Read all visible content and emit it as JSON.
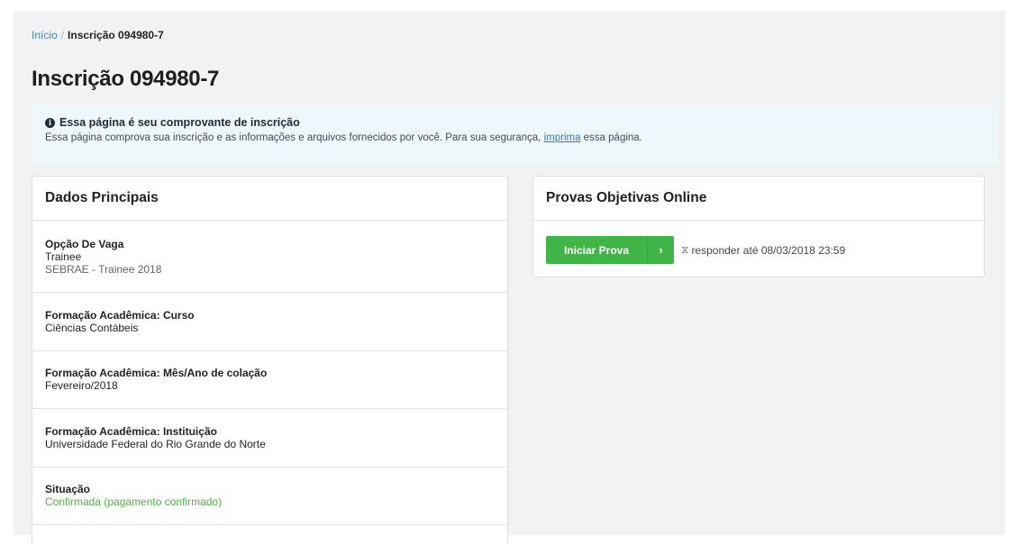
{
  "breadcrumb": {
    "home": "Início",
    "separator": "/",
    "current": "Inscrição 094980-7"
  },
  "page_title": "Inscrição 094980-7",
  "alert": {
    "icon": "info-circle-icon",
    "title": "Essa página é seu comprovante de inscrição",
    "text_before": "Essa página comprova sua inscrição e as informações e arquivos fornecidos por você. Para sua segurança, ",
    "link": "imprima",
    "text_after": " essa página."
  },
  "main_panel": {
    "heading": "Dados Principais",
    "items": [
      {
        "label": "Opção De Vaga",
        "value": "Trainee",
        "sub": "SEBRAE - Trainee 2018"
      },
      {
        "label": "Formação Acadêmica: Curso",
        "value": "Ciências Contábeis"
      },
      {
        "label": "Formação Acadêmica: Mês/Ano de colação",
        "value": "Fevereiro/2018"
      },
      {
        "label": "Formação Acadêmica: Instituição",
        "value": "Universidade Federal do Rio Grande do Norte"
      },
      {
        "label": "Situação",
        "value": "Confirmada (pagamento confirmado)"
      }
    ]
  },
  "exams_panel": {
    "heading": "Provas Objetivas Online",
    "start_button": "Iniciar Prova",
    "start_arrow": "›",
    "deadline_icon": "hourglass-icon",
    "deadline": "responder até 08/03/2018 23:59"
  },
  "colors": {
    "success": "#4fb145",
    "button": "#3fb548",
    "link": "#3a8dc7",
    "alert_bg": "#eef8fb"
  }
}
